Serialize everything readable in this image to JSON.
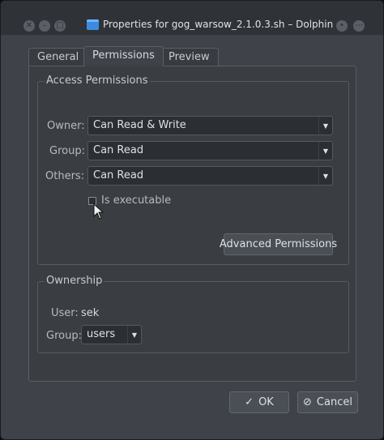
{
  "window": {
    "title": "Properties for gog_warsow_2.1.0.3.sh – Dolphin"
  },
  "tabs": [
    {
      "label": "General"
    },
    {
      "label": "Permissions"
    },
    {
      "label": "Preview"
    }
  ],
  "access": {
    "title": "Access Permissions",
    "owner_label": "Owner:",
    "owner_value": "Can Read & Write",
    "group_label": "Group:",
    "group_value": "Can Read",
    "others_label": "Others:",
    "others_value": "Can Read",
    "executable_label": "Is executable",
    "advanced_button": "Advanced Permissions"
  },
  "ownership": {
    "title": "Ownership",
    "user_label": "User:",
    "user_value": "sek",
    "group_label": "Group:",
    "group_value": "users"
  },
  "footer": {
    "ok_label": "OK",
    "cancel_label": "Cancel"
  },
  "colors": {
    "window_bg": "#3f4248",
    "titlebar_bg": "#2f3237",
    "accent": "#3d8be0"
  }
}
